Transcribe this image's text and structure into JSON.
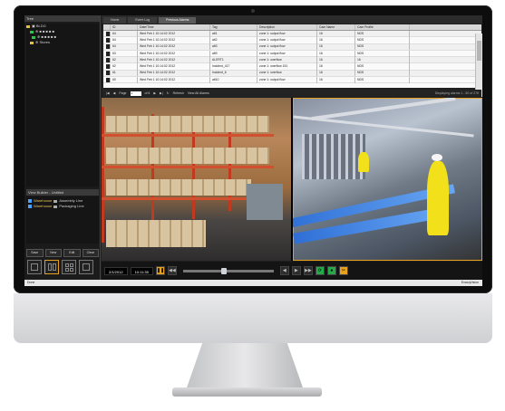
{
  "left_pane": {
    "title": "Tree",
    "tree": [
      {
        "label": "▣ BLDG",
        "color": "#e0c040"
      },
      {
        "label": "⊕ ■ ■ ■ ■ ■",
        "color": "#2ec24a"
      },
      {
        "label": "⊕ ■ ■ ■ ■ ■",
        "color": "#2ec24a"
      },
      {
        "label": "⊕ Stores",
        "color": "#e0c040"
      }
    ],
    "layout_title": "View Builder - Untitled",
    "layouts": [
      {
        "link": "Warehouse",
        "name": "Assembly Line"
      },
      {
        "link": "Warehouse",
        "name": "Packaging Line"
      }
    ],
    "layout_buttons": [
      "Save",
      "New",
      "Edit",
      "Clear"
    ]
  },
  "tabs": [
    "Home",
    "Event Log",
    "Previous Alarms"
  ],
  "table": {
    "headers": [
      "",
      "ID",
      "Date/Time",
      "Tag",
      "Description",
      "Cam Name",
      "Cam Profile"
    ],
    "rows": [
      [
        "",
        "64",
        "Wed Feb 1 10:14:02 2012",
        "alt1",
        "zone 1: output flow",
        "16",
        "NDS"
      ],
      [
        "",
        "64",
        "Wed Feb 1 10:14:02 2012",
        "alt2",
        "zone 1: output flow",
        "16",
        "NDS"
      ],
      [
        "",
        "64",
        "Wed Feb 1 10:14:02 2012",
        "alt3",
        "zone 1: output flow",
        "16",
        "NDS"
      ],
      [
        "",
        "63",
        "Wed Feb 1 10:14:02 2012",
        "alt9",
        "zone 1: output flow",
        "16",
        "NDS"
      ],
      [
        "",
        "62",
        "Wed Feb 1 10:14:02 2012",
        "ALERT1",
        "zone 1: overflow",
        "16",
        "16"
      ],
      [
        "",
        "62",
        "Wed Feb 1 10:14:02 2012",
        "Incident_417",
        "zone 1: overflow 151",
        "16",
        "NDS"
      ],
      [
        "",
        "61",
        "Wed Feb 1 10:14:02 2012",
        "Incident_6",
        "zone 1: overflow",
        "16",
        "NDS"
      ],
      [
        "",
        "60",
        "Wed Feb 1 10:14:02 2012",
        "alt10",
        "zone 1: output flow",
        "16",
        "NDS"
      ]
    ]
  },
  "pager": {
    "page_label": "Page",
    "page_value": "1",
    "of_label": "of 6",
    "refresh_label": "Refresh",
    "view_all_label": "View All Alarms",
    "right_text": "Displaying alarms 1 - 50 of 275"
  },
  "controls": {
    "date": "2/1/2012",
    "time": "10:11:35"
  },
  "status": {
    "left": "Done",
    "right": "ExacqVision"
  }
}
